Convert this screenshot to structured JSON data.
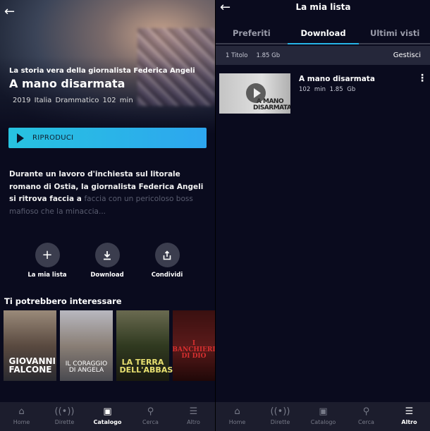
{
  "left": {
    "subtitle": "La storia vera della giornalista Federica Angeli",
    "title": "A mano disarmata",
    "meta": "2019  Italia  Drammatico  102 min",
    "play_label": "RIPRODUCI",
    "description": "Durante un lavoro d'inchiesta sul litorale romano di Ostia, la giornalista Federica Angeli si ritrova faccia a",
    "description_faded": "faccia con un pericoloso boss mafioso che la minaccia...",
    "actions": [
      {
        "label": "La mia lista",
        "icon": "plus-icon"
      },
      {
        "label": "Download",
        "icon": "download-icon"
      },
      {
        "label": "Condividi",
        "icon": "share-icon"
      }
    ],
    "section_title": "Ti potrebbero interessare",
    "posters": [
      {
        "title": "GIOVANNI FALCONE"
      },
      {
        "title": "IL CORAGGIO DI ANGELA"
      },
      {
        "title": "LA TERRA DELL'ABBASTANZA"
      },
      {
        "title": "I BANCHIERI DI DIO"
      }
    ]
  },
  "right": {
    "header_title": "La mia lista",
    "tabs": [
      "Preferiti",
      "Download",
      "Ultimi visti"
    ],
    "active_tab": "Download",
    "info_count": "1 Titolo",
    "info_size": "1.85 Gb",
    "manage_label": "Gestisci",
    "items": [
      {
        "title": "A mano disarmata",
        "duration": "102 min",
        "size": "1.85 Gb",
        "thumb_text": "A MANO DISARMATA"
      }
    ]
  },
  "nav": [
    "Home",
    "Dirette",
    "Catalogo",
    "Cerca",
    "Altro"
  ],
  "nav_active_left": "Catalogo",
  "nav_active_right": "Altro",
  "colors": {
    "accent": "#27b4e6",
    "background": "#0a0b1e",
    "nav_bg": "#1c1d2d"
  }
}
